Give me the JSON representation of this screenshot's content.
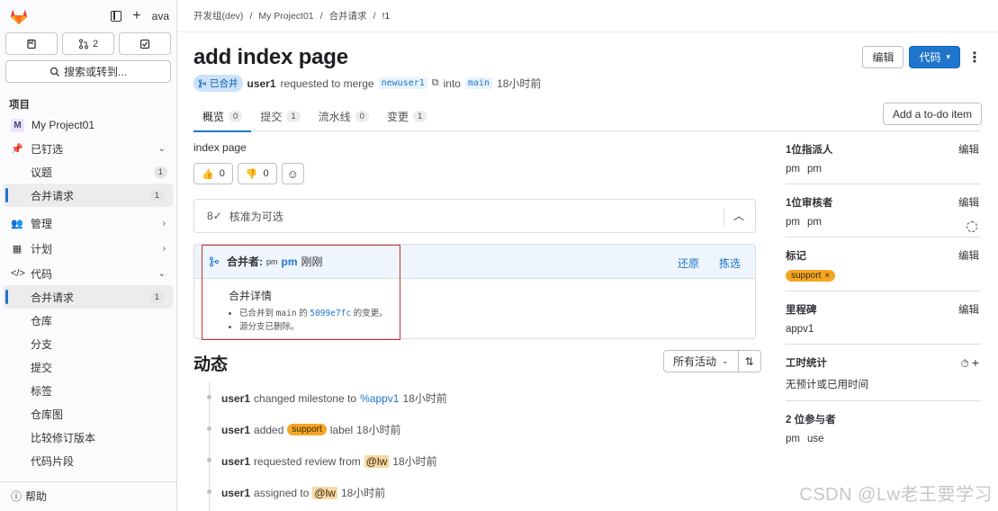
{
  "sidebar": {
    "top_right_text": "ava",
    "btn_mr_count": "2",
    "search_label": "搜索或转到...",
    "section_label": "项目",
    "items": [
      {
        "label": "My Project01"
      },
      {
        "label": "已钉选"
      },
      {
        "label": "议题",
        "count": "1"
      },
      {
        "label": "合并请求",
        "count": "1"
      },
      {
        "label": "管理"
      },
      {
        "label": "计划"
      },
      {
        "label": "代码"
      },
      {
        "label": "合并请求",
        "count": "1"
      },
      {
        "label": "仓库"
      },
      {
        "label": "分支"
      },
      {
        "label": "提交"
      },
      {
        "label": "标签"
      },
      {
        "label": "仓库图"
      },
      {
        "label": "比较修订版本"
      },
      {
        "label": "代码片段"
      }
    ],
    "help": "帮助"
  },
  "breadcrumb": [
    "开发组(dev)",
    "My Project01",
    "合并请求",
    "!1"
  ],
  "mr": {
    "title": "add index page",
    "status": "已合并",
    "author": "user1",
    "requested_text": "requested to merge",
    "source_branch": "newuser1",
    "into_text": "into",
    "target_branch": "main",
    "time": "18小时前",
    "edit_label": "编辑",
    "code_label": "代码"
  },
  "tabs": [
    {
      "label": "概览",
      "count": "0"
    },
    {
      "label": "提交",
      "count": "1"
    },
    {
      "label": "流水线",
      "count": "0"
    },
    {
      "label": "变更",
      "count": "1"
    }
  ],
  "todo_label": "Add a to-do item",
  "description": "index page",
  "reactions": {
    "thumbsup": "0",
    "thumbsdown": "0"
  },
  "approval_text": "核准为可选",
  "merge_widget": {
    "merged_by_label": "合并者:",
    "avatar_text": "pm",
    "user": "pm",
    "when": "刚刚",
    "revert": "还原",
    "cherry_pick": "拣选",
    "details_title": "合并详情",
    "line1_pre": "已合并到",
    "line1_branch": "main",
    "line1_mid": "的",
    "line1_sha": "5099e7fc",
    "line1_post": "的变更。",
    "line2": "源分支已删除。"
  },
  "activity": {
    "title": "动态",
    "filter": "所有活动",
    "items": [
      {
        "user": "user1",
        "text": "changed milestone to",
        "link": "%appv1",
        "time": "18小时前"
      },
      {
        "user": "user1",
        "text": "added",
        "label": "support",
        "text2": "label",
        "time": "18小时前"
      },
      {
        "user": "user1",
        "text": "requested review from",
        "mention": "@lw",
        "time": "18小时前"
      },
      {
        "user": "user1",
        "text": "assigned to",
        "mention": "@lw",
        "time": "18小时前"
      }
    ]
  },
  "right": {
    "assignee_title": "1位指派人",
    "assignee_avatar": "pm",
    "assignee": "pm",
    "reviewer_title": "1位审核者",
    "reviewer_avatar": "pm",
    "reviewer": "pm",
    "labels_title": "标记",
    "label": "support",
    "milestone_title": "里程碑",
    "milestone": "appv1",
    "time_title": "工时统计",
    "time_value": "无预计或已用时间",
    "participants_title": "2 位参与者",
    "participant_1": "pm",
    "participant_2": "use",
    "edit": "编辑"
  },
  "watermark": "CSDN @Lw老王要学习",
  "colors": {
    "accent": "#1f75cb",
    "label": "#f5a623",
    "annotation": "#d0302e"
  }
}
